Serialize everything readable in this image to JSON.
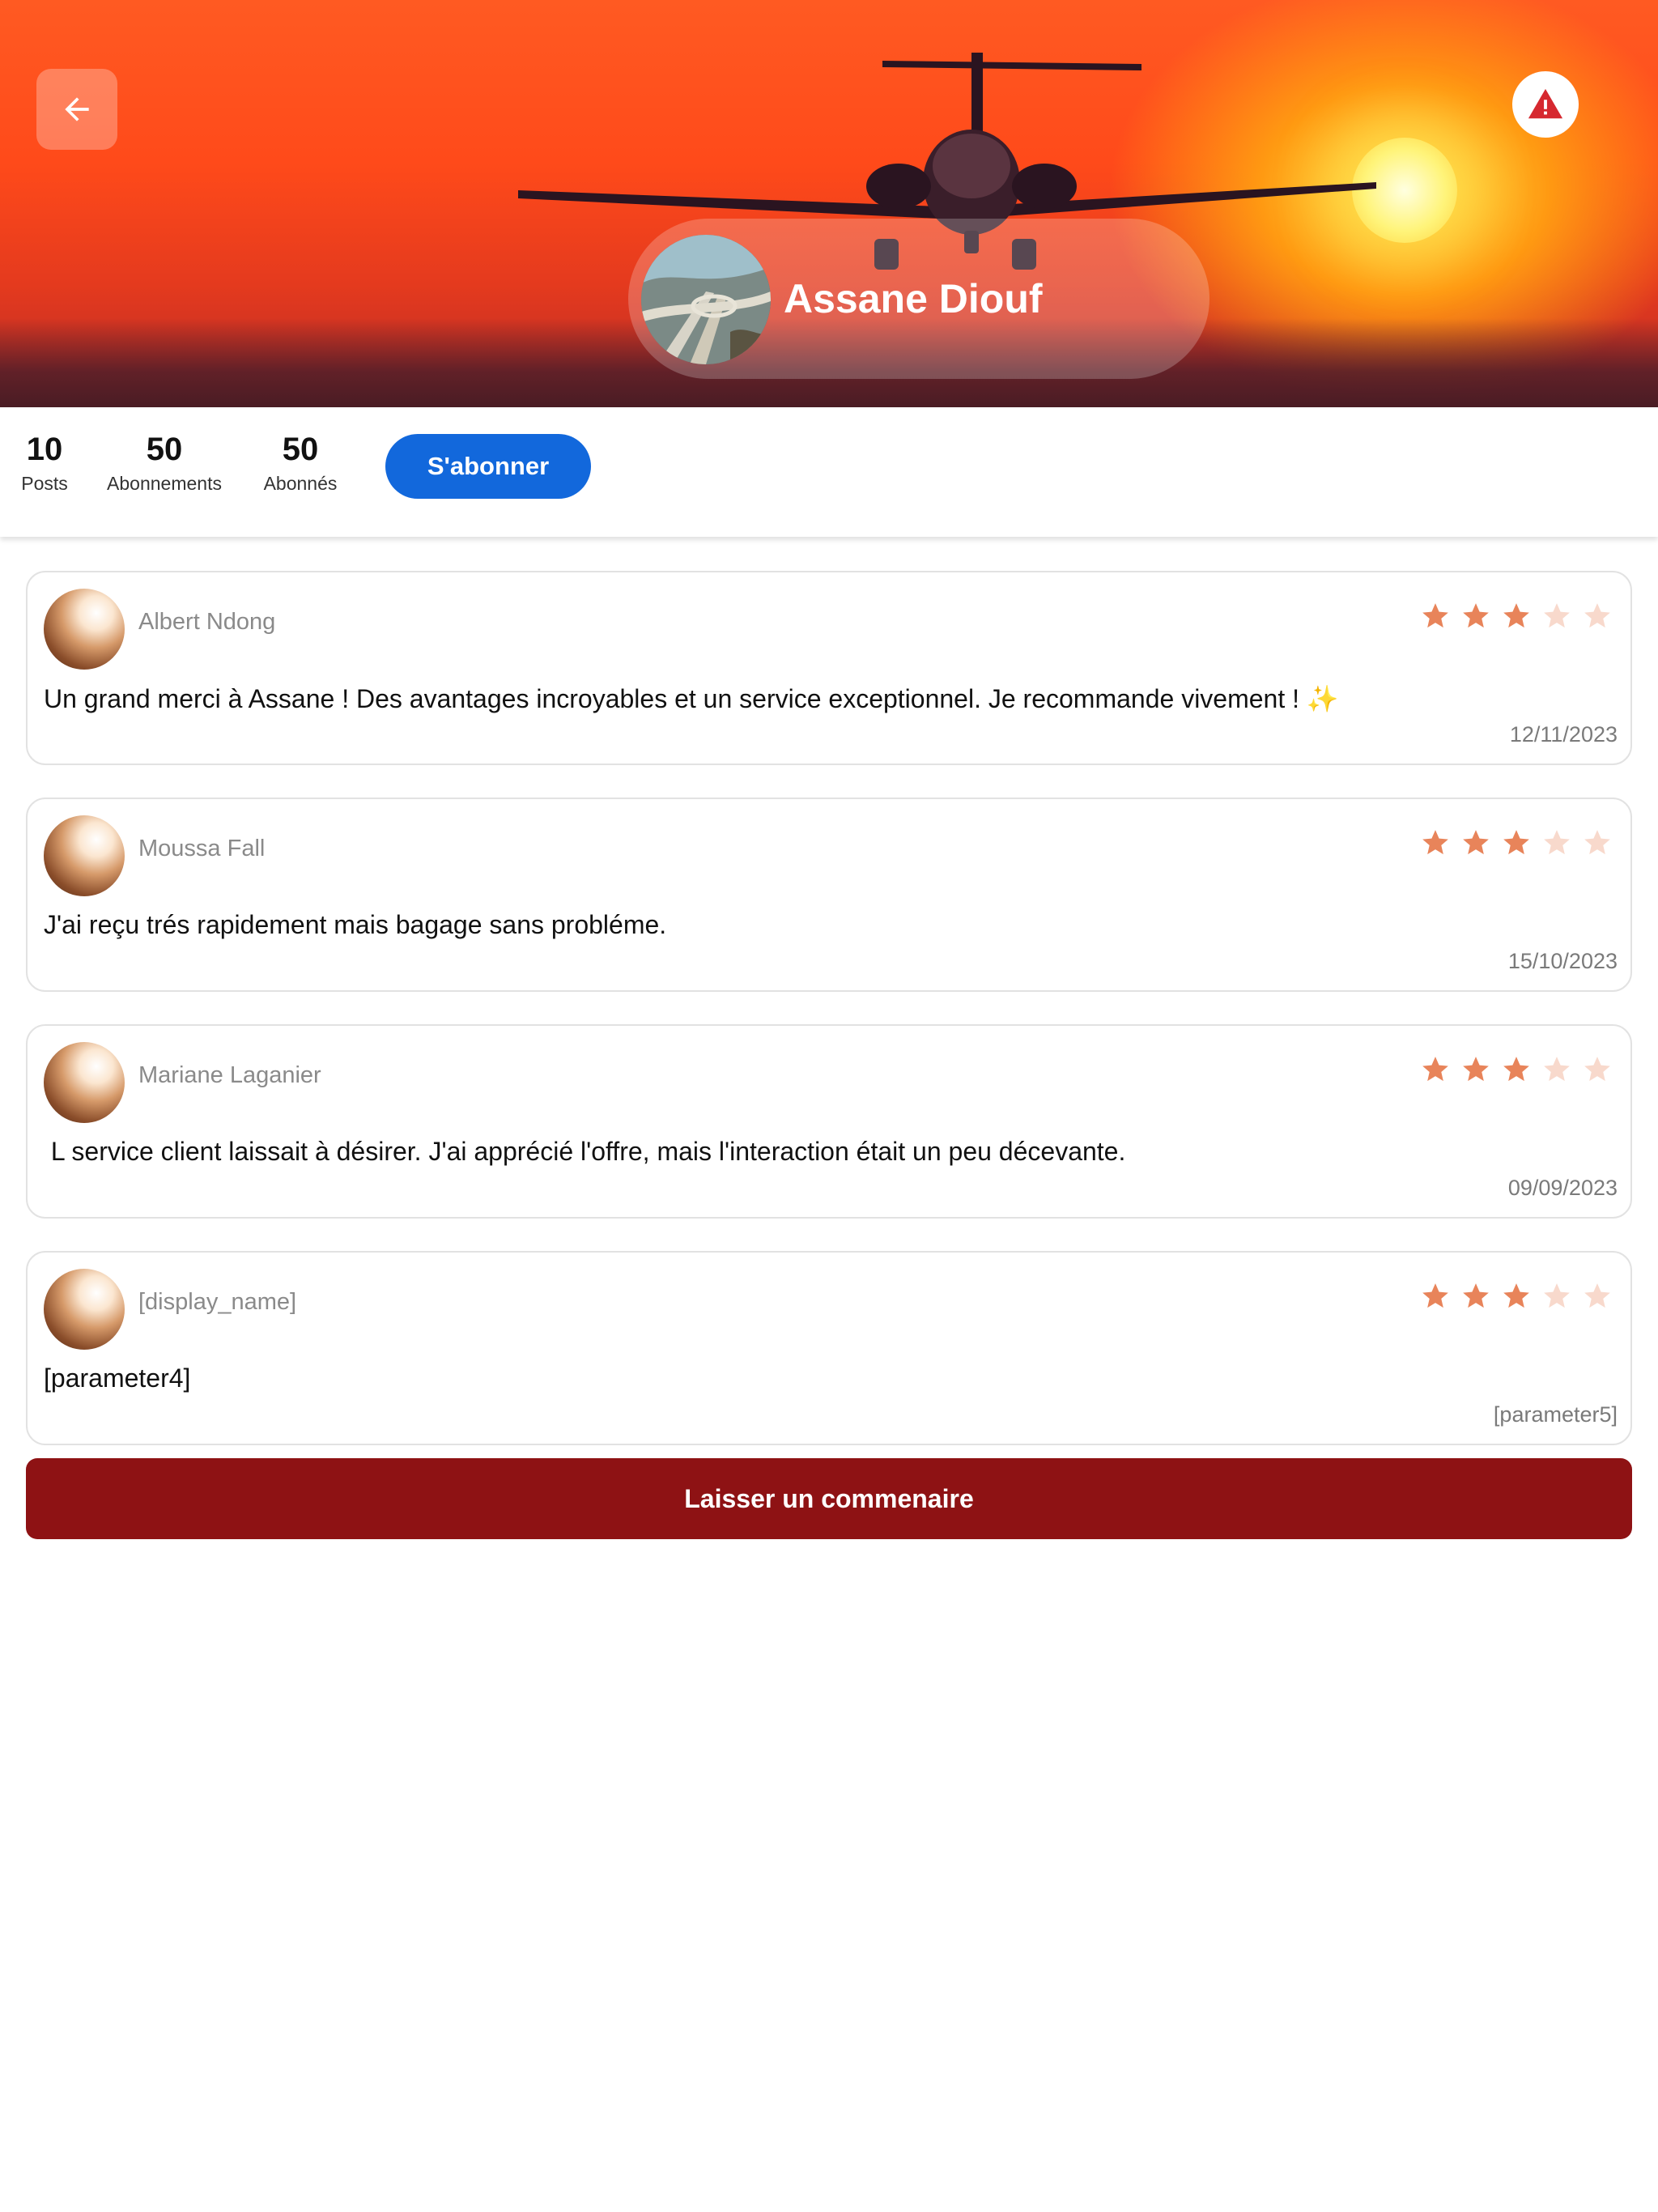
{
  "profile": {
    "name": "Assane Diouf"
  },
  "stats": [
    {
      "value": "10",
      "label": "Posts"
    },
    {
      "value": "50",
      "label": "Abonnements"
    },
    {
      "value": "50",
      "label": "Abonnés"
    }
  ],
  "follow_label": "S'abonner",
  "icons": {
    "back": "arrow-left-icon",
    "report": "warning-triangle-icon"
  },
  "colors": {
    "primary_blue": "#1268dc",
    "comment_red": "#8e1214",
    "star_filled": "#e8845a",
    "star_empty": "#f8d9cc"
  },
  "reviews": [
    {
      "author": "Albert Ndong",
      "rating": 3,
      "text": "Un grand merci à Assane ! Des avantages incroyables et un service exceptionnel. Je recommande vivement ! ✨",
      "date": "12/11/2023"
    },
    {
      "author": "Moussa Fall",
      "rating": 3,
      "text": "J'ai reçu trés rapidement mais bagage sans probléme.",
      "date": "15/10/2023"
    },
    {
      "author": "Mariane Laganier",
      "rating": 3,
      "text": " L service client laissait à désirer. J'ai apprécié l'offre, mais l'interaction était un peu décevante.",
      "date": "09/09/2023"
    },
    {
      "author": "[display_name]",
      "rating": 3,
      "text": "[parameter4]",
      "date": "[parameter5]"
    }
  ],
  "comment_button_label": "Laisser un commenaire"
}
